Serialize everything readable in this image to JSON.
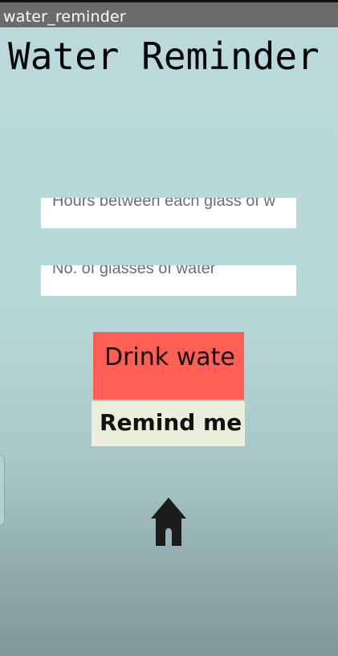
{
  "appbar": {
    "title": "water_reminder"
  },
  "main": {
    "title": "Water Reminder",
    "hours_field": {
      "placeholder": "Hours between each glass of w"
    },
    "glasses_field": {
      "placeholder": "No. of glasses of water"
    },
    "drink_button_label": "Drink wate",
    "remind_button_label": "Remind me"
  },
  "icons": {
    "home": "home-icon"
  },
  "colors": {
    "background": "#b9d9da",
    "drink_button": "#ff5f55",
    "remind_button": "#eaeedb",
    "appbar": "#6b6b6b"
  }
}
